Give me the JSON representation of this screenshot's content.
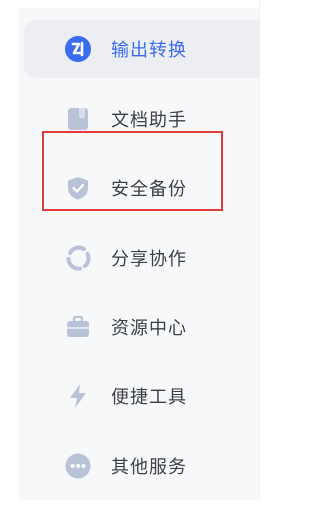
{
  "colors": {
    "accent": "#3a6cf0",
    "icon_inactive": "#b9c2d6",
    "highlight_border": "#e23b3b",
    "active_bg": "#eceef3"
  },
  "menu": {
    "items": [
      {
        "label": "输出转换",
        "icon": "convert-icon",
        "active": true
      },
      {
        "label": "文档助手",
        "icon": "document-icon",
        "active": false
      },
      {
        "label": "安全备份",
        "icon": "shield-icon",
        "active": false
      },
      {
        "label": "分享协作",
        "icon": "share-icon",
        "active": false
      },
      {
        "label": "资源中心",
        "icon": "briefcase-icon",
        "active": false
      },
      {
        "label": "便捷工具",
        "icon": "lightning-icon",
        "active": false
      },
      {
        "label": "其他服务",
        "icon": "more-icon",
        "active": false
      }
    ]
  }
}
